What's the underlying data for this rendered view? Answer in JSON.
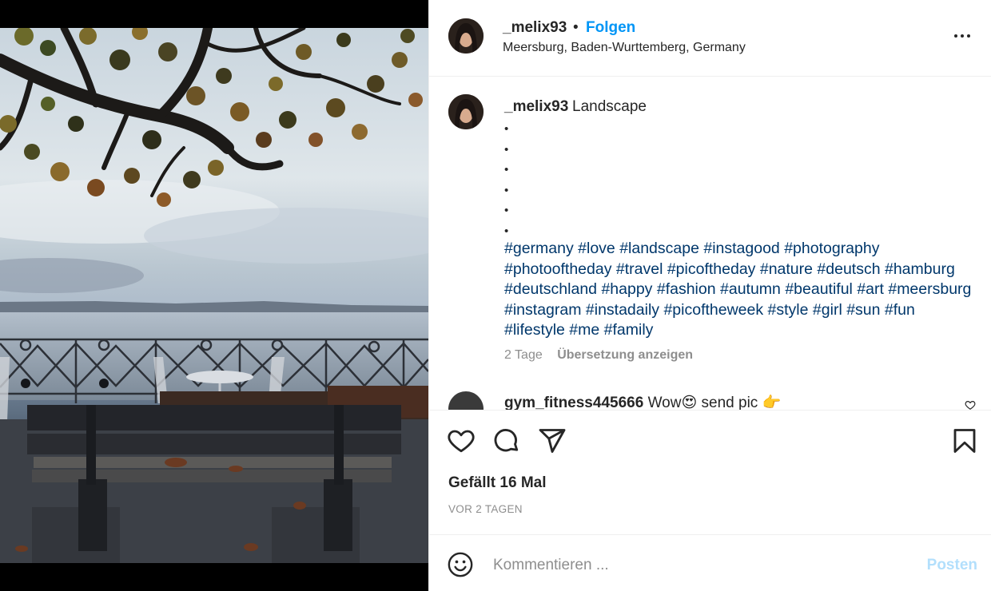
{
  "post": {
    "author": {
      "username": "_melix93",
      "follow_label": "Folgen",
      "separator": "•",
      "location": "Meersburg, Baden-Wurttemberg, Germany"
    },
    "more_icon": "more-horizontal-icon",
    "caption": {
      "username": "_melix93",
      "text": "Landscape",
      "bullets": "•\n•\n•\n•\n•\n•",
      "hashtags": [
        "#germany",
        "#love",
        "#landscape",
        "#instagood",
        "#photography",
        "#photooftheday",
        "#travel",
        "#picoftheday",
        "#nature",
        "#deutsch",
        "#hamburg",
        "#deutschland",
        "#happy",
        "#fashion",
        "#autumn",
        "#beautiful",
        "#art",
        "#meersburg",
        "#instagram",
        "#instadaily",
        "#picoftheweek",
        "#style",
        "#girl",
        "#sun",
        "#fun",
        "#lifestyle",
        "#me",
        "#family"
      ],
      "age": "2 Tage",
      "translate_label": "Übersetzung anzeigen"
    },
    "next_comment": {
      "username": "gym_fitness445666",
      "text": "Wow😍 send pic 👉"
    },
    "actions": {
      "like_icon": "heart-icon",
      "comment_icon": "comment-icon",
      "share_icon": "share-icon",
      "save_icon": "bookmark-icon"
    },
    "likes": "Gefällt 16 Mal",
    "timestamp": "VOR 2 TAGEN",
    "comment_box": {
      "emoji_icon": "emoji-icon",
      "placeholder": "Kommentieren ...",
      "post_label": "Posten"
    }
  },
  "colors": {
    "link_blue": "#0095f6",
    "hashtag": "#00376b",
    "muted": "#8e8e8e",
    "post_disabled": "#b2dffc"
  }
}
